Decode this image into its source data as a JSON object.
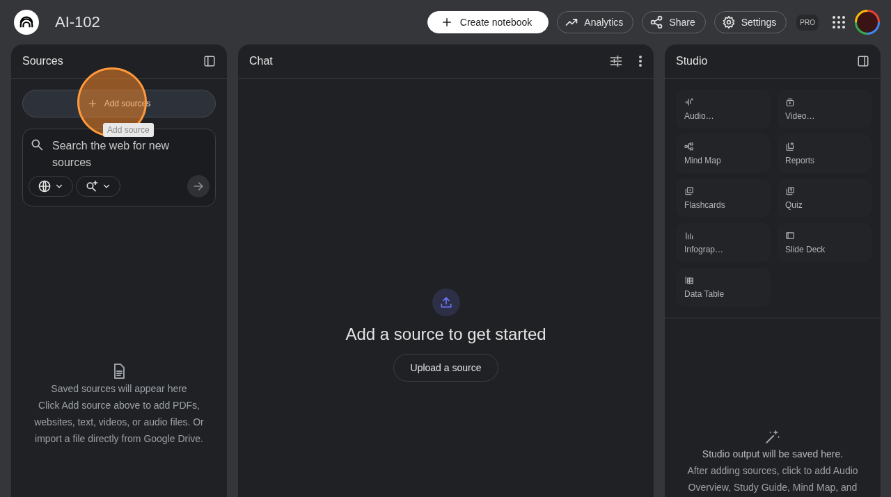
{
  "header": {
    "title": "AI-102",
    "badge": "PRO",
    "buttons": [
      {
        "label": "Create notebook",
        "kind": "create"
      },
      {
        "label": "Analytics",
        "kind": "analytics"
      },
      {
        "label": "Share",
        "kind": "share"
      },
      {
        "label": "Settings",
        "kind": "settings"
      }
    ]
  },
  "sources": {
    "title": "Sources",
    "add_button": "Add sources",
    "tooltip": "Add source",
    "search": {
      "placeholder": "Search the web for new sources"
    },
    "empty_title": "Saved sources will appear here",
    "empty_text": "Click Add source above to add PDFs, websites, text, videos, or audio files. Or import a file directly from Google Drive."
  },
  "chat": {
    "title": "Chat",
    "empty_title": "Add a source to get started",
    "upload_button": "Upload a source"
  },
  "studio": {
    "title": "Studio",
    "tiles": [
      {
        "label": "Audio…",
        "kind": "audio"
      },
      {
        "label": "Video…",
        "kind": "video"
      },
      {
        "label": "Mind Map",
        "kind": "mindmap"
      },
      {
        "label": "Reports",
        "kind": "reports"
      },
      {
        "label": "Flashcards",
        "kind": "flashcards"
      },
      {
        "label": "Quiz",
        "kind": "quiz"
      },
      {
        "label": "Infograp…",
        "kind": "infographic"
      },
      {
        "label": "Slide Deck",
        "kind": "slides"
      },
      {
        "label": "Data Table",
        "kind": "table"
      }
    ],
    "empty_title": "Studio output will be saved here.",
    "empty_text": "After adding sources, click to add Audio Overview, Study Guide, Mind Map, and"
  }
}
